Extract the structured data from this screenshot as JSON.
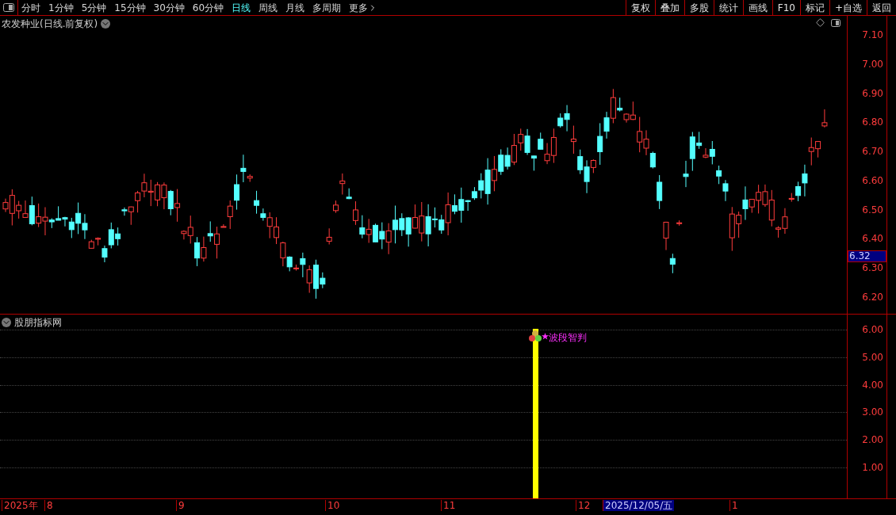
{
  "toolbar": {
    "periods": [
      {
        "label": "分时",
        "selected": false
      },
      {
        "label": "1分钟",
        "selected": false
      },
      {
        "label": "5分钟",
        "selected": false
      },
      {
        "label": "15分钟",
        "selected": false
      },
      {
        "label": "30分钟",
        "selected": false
      },
      {
        "label": "60分钟",
        "selected": false
      },
      {
        "label": "日线",
        "selected": true
      },
      {
        "label": "周线",
        "selected": false
      },
      {
        "label": "月线",
        "selected": false
      },
      {
        "label": "多周期",
        "selected": false
      }
    ],
    "more": "更多",
    "buttons": [
      "复权",
      "叠加",
      "多股",
      "统计",
      "画线",
      "F10",
      "标记",
      "+自选",
      "返回"
    ]
  },
  "main_chart": {
    "title": "农发种业(日线.前复权)",
    "price_axis": [
      "7.10",
      "7.00",
      "6.90",
      "6.80",
      "6.70",
      "6.60",
      "6.50",
      "6.40",
      "6.30",
      "6.20"
    ],
    "current_price": "6.32"
  },
  "indicator": {
    "title": "股朋指标网",
    "axis": [
      "6.00",
      "5.00",
      "4.00",
      "3.00",
      "2.00",
      "1.00"
    ],
    "signal_label": "波段智判"
  },
  "date_axis": [
    {
      "label": "2025年",
      "selected": false
    },
    {
      "label": "8",
      "selected": false
    },
    {
      "label": "9",
      "selected": false
    },
    {
      "label": "10",
      "selected": false
    },
    {
      "label": "11",
      "selected": false
    },
    {
      "label": "12",
      "selected": false
    },
    {
      "label": "2025/12/05/五",
      "selected": true
    },
    {
      "label": "1",
      "selected": false
    }
  ]
}
